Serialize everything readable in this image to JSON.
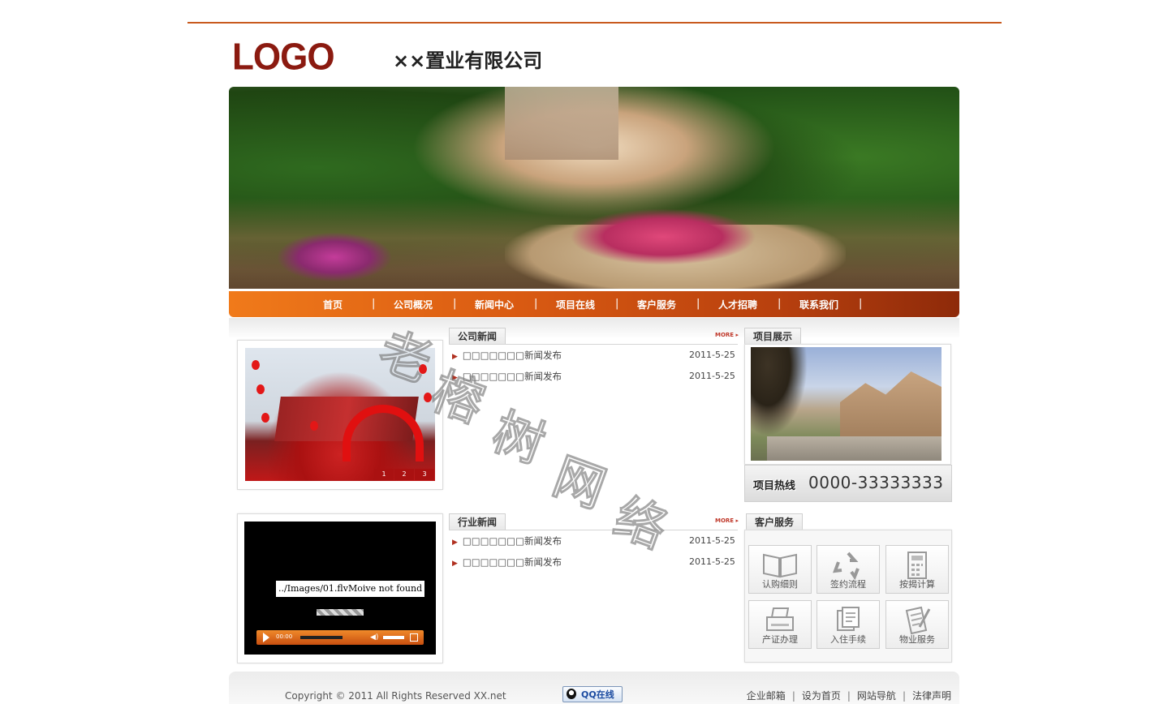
{
  "header": {
    "logo": "LOGO",
    "company": "××置业有限公司"
  },
  "nav": [
    "首页",
    "公司概况",
    "新闻中心",
    "项目在线",
    "客户服务",
    "人才招聘",
    "联系我们"
  ],
  "company_news": {
    "title": "公司新闻",
    "more": "MORE",
    "items": [
      {
        "text": "□□□□□□□新闻发布",
        "date": "2011-5-25"
      },
      {
        "text": "□□□□□□□新闻发布",
        "date": "2011-5-25"
      }
    ]
  },
  "industry_news": {
    "title": "行业新闻",
    "more": "MORE",
    "items": [
      {
        "text": "□□□□□□□新闻发布",
        "date": "2011-5-25"
      },
      {
        "text": "□□□□□□□新闻发布",
        "date": "2011-5-25"
      }
    ]
  },
  "slider": {
    "pages": [
      "1",
      "2",
      "3"
    ]
  },
  "video": {
    "error": "../Images/01.flvMoive not found",
    "time": "00:00"
  },
  "projects": {
    "title": "项目展示",
    "hotline_label": "项目热线",
    "hotline_number": "0000-33333333"
  },
  "services": {
    "title": "客户服务",
    "items": [
      {
        "label": "认购细则",
        "icon": "book-icon"
      },
      {
        "label": "签约流程",
        "icon": "recycle-icon"
      },
      {
        "label": "按揭计算",
        "icon": "calculator-icon"
      },
      {
        "label": "产证办理",
        "icon": "printer-icon"
      },
      {
        "label": "入住手续",
        "icon": "document-icon"
      },
      {
        "label": "物业服务",
        "icon": "notepad-icon"
      }
    ]
  },
  "footer": {
    "copyright": "Copyright © 2011 All Rights Reserved XX.net",
    "qq": "QQ在线",
    "links": [
      "企业邮箱",
      "设为首页",
      "网站导航",
      "法律声明"
    ]
  },
  "watermark": "老榕树网络"
}
